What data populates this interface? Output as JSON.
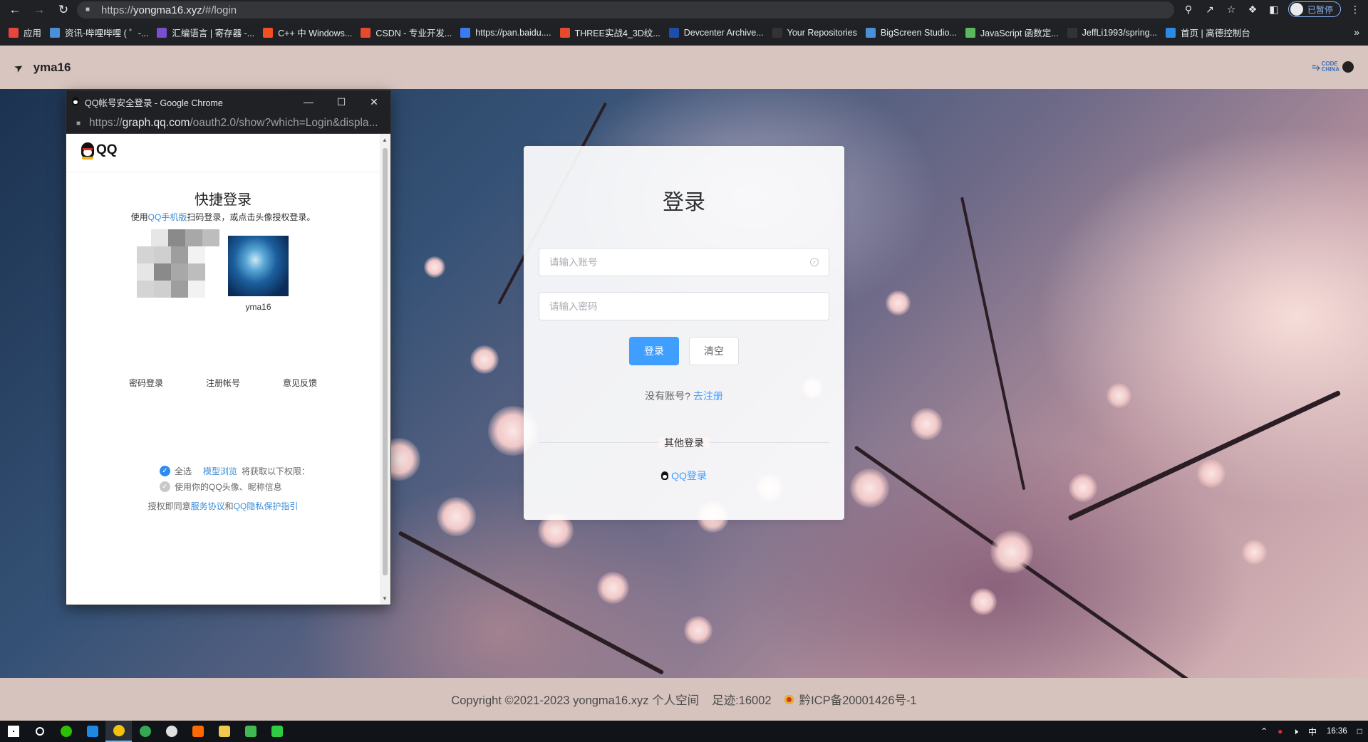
{
  "browser": {
    "url_prefix": "https://",
    "url_host": "yongma16.xyz",
    "url_path": "/#/login",
    "profile_status": "已暂停",
    "icons": [
      "back-arrow-icon",
      "forward-arrow-icon",
      "reload-icon",
      "key-icon",
      "share-icon",
      "star-icon",
      "extensions-icon",
      "sidebar-icon",
      "profile-icon",
      "kebab-menu-icon"
    ]
  },
  "bookmarks": [
    {
      "label": "应用",
      "color": "#e8453c"
    },
    {
      "label": "资讯-哔哩哔哩 ( ゜-...",
      "color": "#4a90d9"
    },
    {
      "label": "汇编语言 | 寄存器 -...",
      "color": "#7a4fcf"
    },
    {
      "label": "C++ 中 Windows...",
      "color": "#f25022"
    },
    {
      "label": "CSDN - 专业开发...",
      "color": "#e64a2e"
    },
    {
      "label": "https://pan.baidu....",
      "color": "#3a7bf0"
    },
    {
      "label": "THREE实战4_3D纹...",
      "color": "#e64a2e"
    },
    {
      "label": "Devcenter Archive...",
      "color": "#1d4fa8"
    },
    {
      "label": "Your Repositories",
      "color": "#333333"
    },
    {
      "label": "BigScreen Studio...",
      "color": "#4a90d9"
    },
    {
      "label": "JavaScript 函数定...",
      "color": "#5cb85c"
    },
    {
      "label": "JeffLi1993/spring...",
      "color": "#333333"
    },
    {
      "label": "首页 | 高德控制台",
      "color": "#2a8ae6"
    }
  ],
  "site": {
    "logo_text": "yma16",
    "codechina_line1": "CODE",
    "codechina_line2": "CHINA"
  },
  "login": {
    "title": "登录",
    "account_placeholder": "请输入账号",
    "password_placeholder": "请输入密码",
    "login_button": "登录",
    "clear_button": "清空",
    "no_account": "没有账号?",
    "register_link": "去注册",
    "other_login": "其他登录",
    "qq_login": "QQ登录"
  },
  "footer": {
    "copyright": "Copyright ©2021-2023 yongma16.xyz 个人空间",
    "visits": "足迹:16002",
    "icp": "黔ICP备20001426号-1"
  },
  "popup": {
    "window_title": "QQ帐号安全登录 - Google Chrome",
    "url_prefix": "https://",
    "url_host": "graph.qq.com",
    "url_rest": "/oauth2.0/show?which=Login&displa...",
    "brand": "QQ",
    "quick_title": "快捷登录",
    "quick_sub_pre": "使用",
    "quick_sub_link": "QQ手机版",
    "quick_sub_post": "扫码登录，或点击头像授权登录。",
    "account_name": "yma16",
    "link_password": "密码登录",
    "link_register": "注册帐号",
    "link_feedback": "意见反馈",
    "perm_all": "全选",
    "perm_app": "模型浏览",
    "perm_will": "将获取以下权限：",
    "perm_item": "使用你的QQ头像、昵称信息",
    "agree_pre": "授权即同意",
    "agree_service": "服务协议",
    "agree_and": "和",
    "agree_privacy": "QQ隐私保护指引"
  },
  "taskbar": {
    "apps": [
      {
        "name": "start-icon",
        "color": "#ffffff"
      },
      {
        "name": "search-icon",
        "color": "#ffffff"
      },
      {
        "name": "wechat-icon",
        "color": "#2dc100"
      },
      {
        "name": "webstorm-icon",
        "color": "#1e88e5"
      },
      {
        "name": "chrome-icon",
        "color": "#f4c20d"
      },
      {
        "name": "chrome-dev-icon",
        "color": "#34a853"
      },
      {
        "name": "chat-icon",
        "color": "#e0e0e0"
      },
      {
        "name": "sublime-icon",
        "color": "#ff6a00"
      },
      {
        "name": "folder-icon",
        "color": "#f2c94c"
      },
      {
        "name": "image-viewer-icon",
        "color": "#3fb950"
      },
      {
        "name": "terminal-icon",
        "color": "#2ecc40"
      }
    ],
    "ime": "中",
    "time": "16:36"
  }
}
